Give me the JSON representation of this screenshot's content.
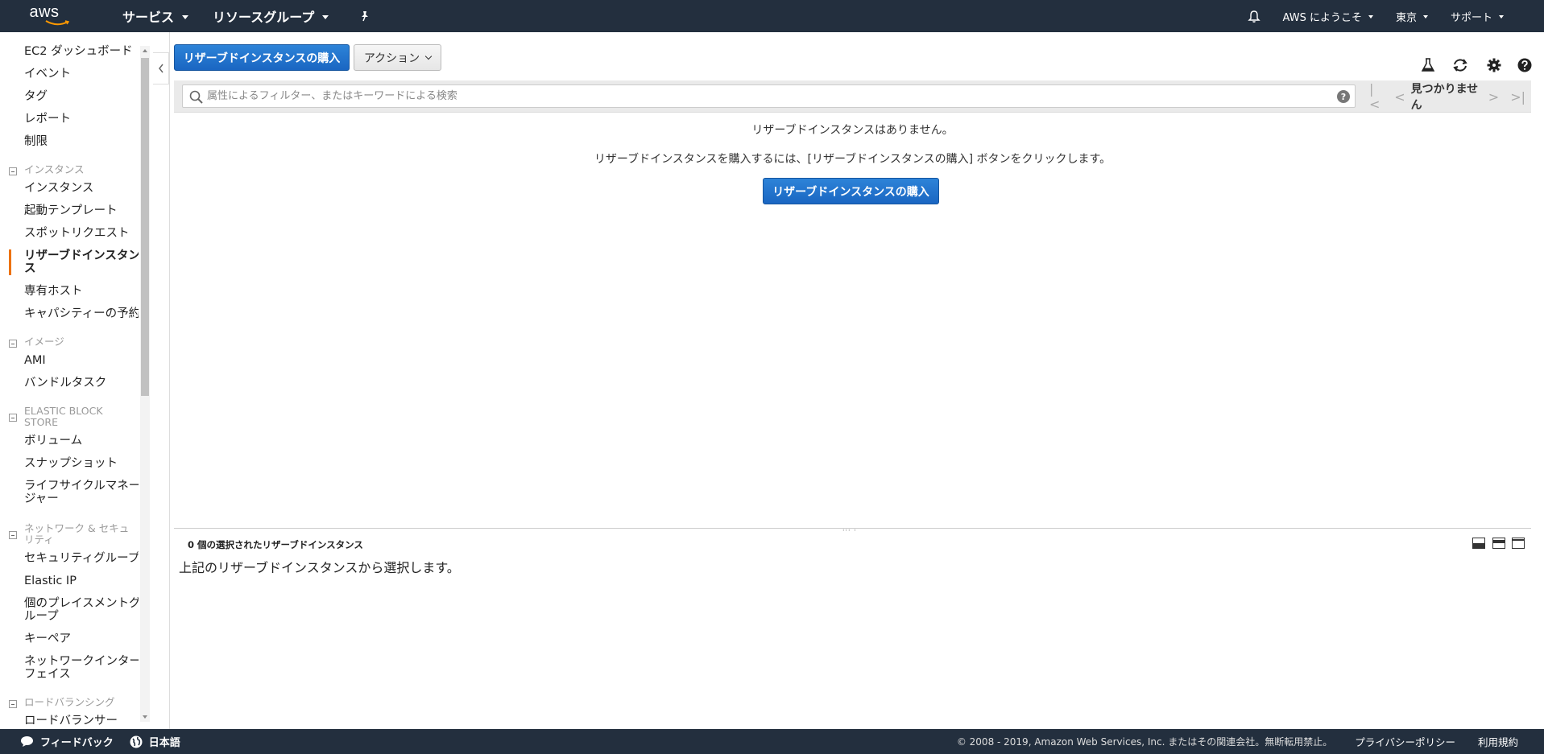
{
  "topnav": {
    "logo_text": "aws",
    "services": "サービス",
    "resource_groups": "リソースグループ",
    "account": "AWS にようこそ",
    "region": "東京",
    "support": "サポート"
  },
  "sidebar": {
    "items_top": [
      "EC2 ダッシュボード",
      "イベント",
      "タグ",
      "レポート",
      "制限"
    ],
    "section_instances": "インスタンス",
    "items_instances": [
      "インスタンス",
      "起動テンプレート",
      "スポットリクエスト",
      "リザーブドインスタンス",
      "専有ホスト",
      "キャパシティーの予約"
    ],
    "section_images": "イメージ",
    "items_images": [
      "AMI",
      "バンドルタスク"
    ],
    "section_ebs": "ELASTIC BLOCK STORE",
    "items_ebs": [
      "ボリューム",
      "スナップショット",
      "ライフサイクルマネージャー"
    ],
    "section_network": "ネットワーク & セキュリティ",
    "items_network": [
      "セキュリティグループ",
      "Elastic IP",
      "個のプレイスメントグループ",
      "キーペア",
      "ネットワークインターフェイス"
    ],
    "section_lb": "ロードバランシング",
    "items_lb": [
      "ロードバランサー"
    ]
  },
  "toolbar": {
    "purchase_button": "リザーブドインスタンスの購入",
    "actions_button": "アクション"
  },
  "filter": {
    "placeholder": "属性によるフィルター、またはキーワードによる検索",
    "pager_text": "見つかりません"
  },
  "empty_state": {
    "line1": "リザーブドインスタンスはありません。",
    "line2": "リザーブドインスタンスを購入するには、[リザーブドインスタンスの購入] ボタンをクリックします。",
    "button": "リザーブドインスタンスの購入"
  },
  "detail": {
    "title": "0 個の選択されたリザーブドインスタンス",
    "body": "上記のリザーブドインスタンスから選択します。"
  },
  "footer": {
    "feedback": "フィードバック",
    "language": "日本語",
    "copyright": "© 2008 - 2019, Amazon Web Services, Inc. またはその関連会社。無断転用禁止。",
    "privacy": "プライバシーポリシー",
    "terms": "利用規約"
  },
  "colors": {
    "nav_bg": "#232f3e",
    "primary": "#1a66c2",
    "active_indicator": "#ec7211"
  }
}
